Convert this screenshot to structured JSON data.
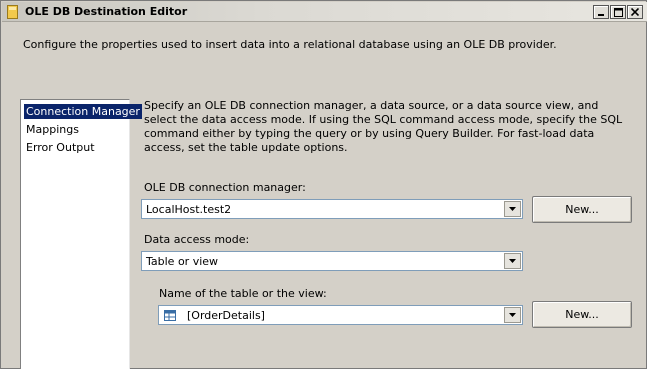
{
  "window": {
    "title": "OLE DB Destination Editor"
  },
  "description": "Configure the properties used to insert data into a relational database using an OLE DB provider.",
  "sidebar": {
    "items": [
      {
        "label": "Connection Manager",
        "selected": true
      },
      {
        "label": "Mappings",
        "selected": false
      },
      {
        "label": "Error Output",
        "selected": false
      }
    ]
  },
  "main": {
    "help_text": "Specify an OLE DB connection manager, a data source, or a data source view, and select the data access mode. If using the SQL command access mode, specify the SQL command either by typing the query or by using Query Builder. For fast-load data access, set the table update options.",
    "connection_manager": {
      "label": "OLE DB connection manager:",
      "value": "LocalHost.test2",
      "new_button": "New..."
    },
    "access_mode": {
      "label": "Data access mode:",
      "value": "Table or view"
    },
    "table": {
      "label": "Name of the table or the view:",
      "value": "[OrderDetails]",
      "new_button": "New..."
    }
  },
  "icons": {
    "window": "ssis-folder-icon",
    "minimize": "minimize-icon",
    "maximize": "maximize-icon",
    "close": "close-icon",
    "dropdown": "chevron-down-icon",
    "table": "table-icon"
  },
  "colors": {
    "selection": "#0a246a",
    "dialog_bg": "#d4d0c8"
  }
}
